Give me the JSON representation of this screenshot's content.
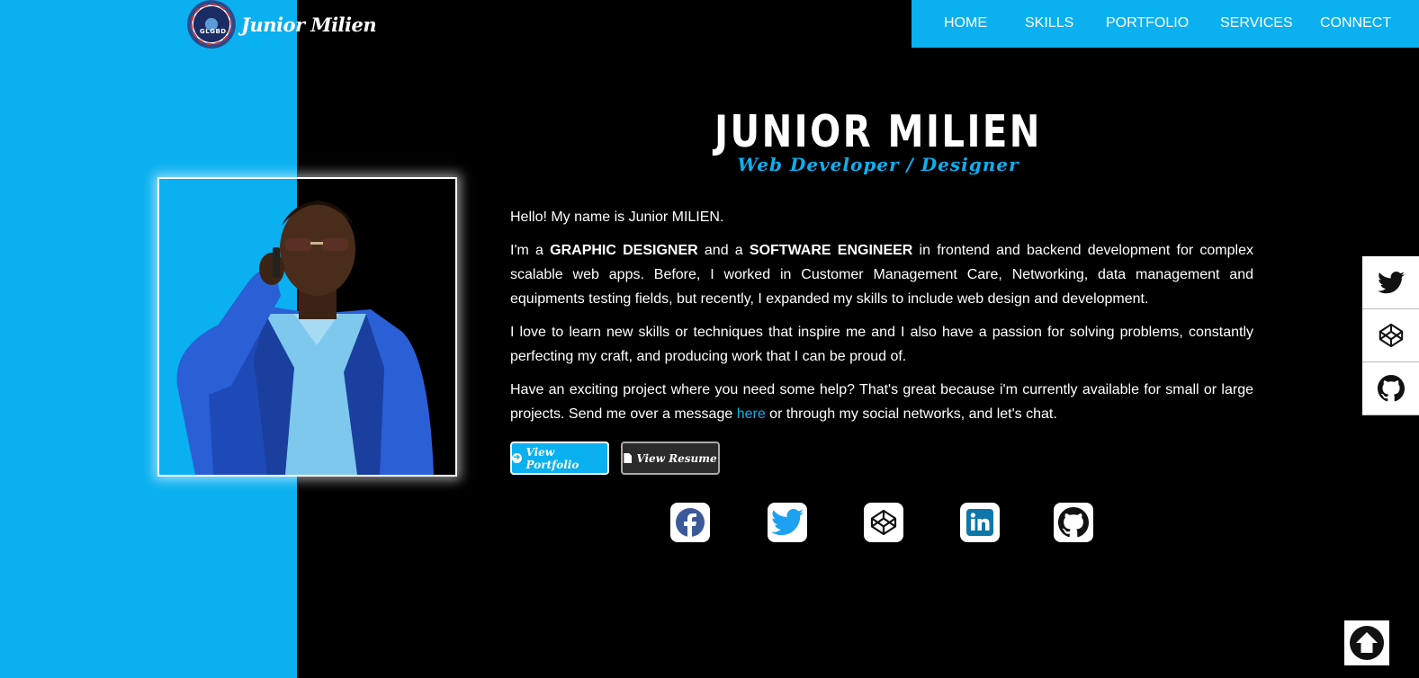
{
  "brand": {
    "name": "Junior Milien",
    "logo_text": "GLGBD"
  },
  "nav": {
    "items": [
      "HOME",
      "SKILLS",
      "PORTFOLIO",
      "SERVICES",
      "CONNECT"
    ]
  },
  "hero": {
    "title": "JUNIOR MILIEN",
    "subtitle": "Web Developer / Designer",
    "bio": {
      "p1": "Hello! My name is Junior MILIEN.",
      "p2_a": "I'm a ",
      "p2_b": "GRAPHIC DESIGNER",
      "p2_c": " and a ",
      "p2_d": "SOFTWARE ENGINEER",
      "p2_e": " in frontend and backend development for complex scalable web apps. Before, I worked in Customer Management Care, Networking, data management and equipments testing fields, but recently, I expanded my skills to include web design and development.",
      "p3": "I love to learn new skills or techniques that inspire me and I also have a passion for solving problems, constantly perfecting my craft, and producing work that I can be proud of.",
      "p4_a": "Have an exciting project where you need some help? That's great because i'm currently available for small or large projects. Send me over a message ",
      "p4_link": "here",
      "p4_b": " or through my social networks, and let's chat."
    },
    "buttons": {
      "portfolio": "View Portfolio",
      "resume": "View Resume"
    }
  },
  "social_row": [
    "facebook-icon",
    "twitter-icon",
    "codepen-icon",
    "linkedin-icon",
    "github-icon"
  ],
  "side_dock": [
    "twitter-icon",
    "codepen-icon",
    "github-icon"
  ],
  "colors": {
    "accent": "#0ab0f0",
    "background": "#000000",
    "text": "#ffffff"
  }
}
